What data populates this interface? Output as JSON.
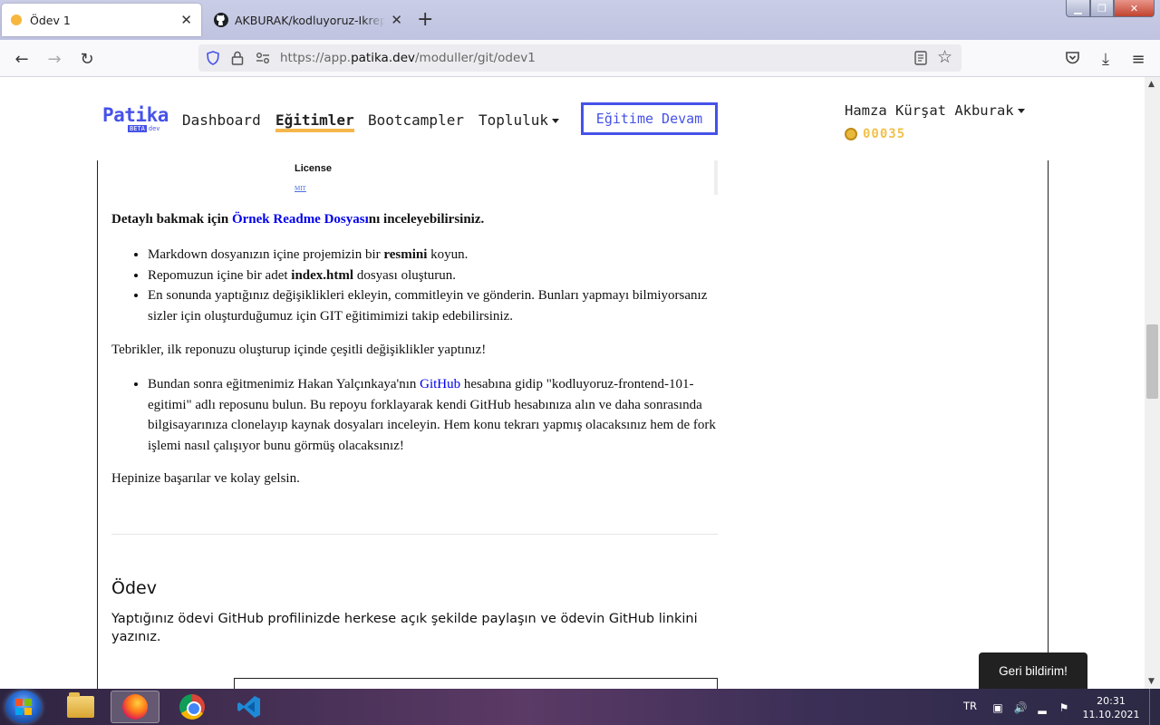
{
  "browser": {
    "tabs": [
      {
        "title": "Ödev 1",
        "active": true
      },
      {
        "title": "AKBURAK/kodluyoruz-Ikrepo: K",
        "active": false
      }
    ],
    "url_prefix": "https://app.",
    "url_domain": "patika.dev",
    "url_path": "/moduller/git/odev1"
  },
  "site": {
    "logo_word": "Patika",
    "logo_beta": "BETA",
    "logo_sub": "dev",
    "menu": [
      {
        "label": "Dashboard"
      },
      {
        "label": "Eğitimler"
      },
      {
        "label": "Bootcampler"
      },
      {
        "label": "Topluluk"
      }
    ],
    "continue_label": "Eğitime Devam",
    "user_name": "Hamza Kürşat Akburak",
    "coins": "00035"
  },
  "readme_preview": {
    "license_heading": "License",
    "license_link": "MIT"
  },
  "content": {
    "detail_prefix": "Detaylı bakmak için ",
    "detail_link": "Örnek Readme Dosyası",
    "detail_suffix": "nı inceleyebilirsiniz.",
    "list1": [
      {
        "a": "Markdown dosyanızın içine projemizin bir ",
        "b": "resmini",
        "c": " koyun."
      },
      {
        "a": "Repomuzun içine bir adet ",
        "b": "index.html",
        "c": " dosyası oluşturun."
      },
      {
        "a": "En sonunda yaptığınız değişiklikleri ekleyin, commitleyin ve gönderin. Bunları yapmayı bilmiyorsanız sizler için oluşturduğumuz için GIT eğitimimizi takip edebilirsiniz.",
        "b": "",
        "c": ""
      }
    ],
    "congrats": "Tebrikler, ilk reponuzu oluşturup içinde çeşitli değişiklikler yaptınız!",
    "list2_prefix": "Bundan sonra eğitmenimiz Hakan Yalçınkaya'nın ",
    "list2_link": "GitHub",
    "list2_suffix": " hesabına gidip \"kodluyoruz-frontend-101-egitimi\" adlı reposunu bulun. Bu repoyu forklayarak kendi GitHub hesabınıza alın ve daha sonrasında bilgisayarınıza clonelayıp kaynak dosyaları inceleyin. Hem konu tekrarı yapmış olacaksınız hem de fork işlemi nasıl çalışıyor bunu görmüş olacaksınız!",
    "closing": "Hepinize başarılar ve kolay gelsin.",
    "odev_title": "Ödev",
    "odev_desc": "Yaptığınız ödevi GitHub profilinizde herkese açık şekilde paylaşın ve ödevin GitHub linkini yazınız."
  },
  "feedback_label": "Geri bildirim!",
  "taskbar": {
    "language": "TR",
    "time": "20:31",
    "date": "11.10.2021"
  }
}
